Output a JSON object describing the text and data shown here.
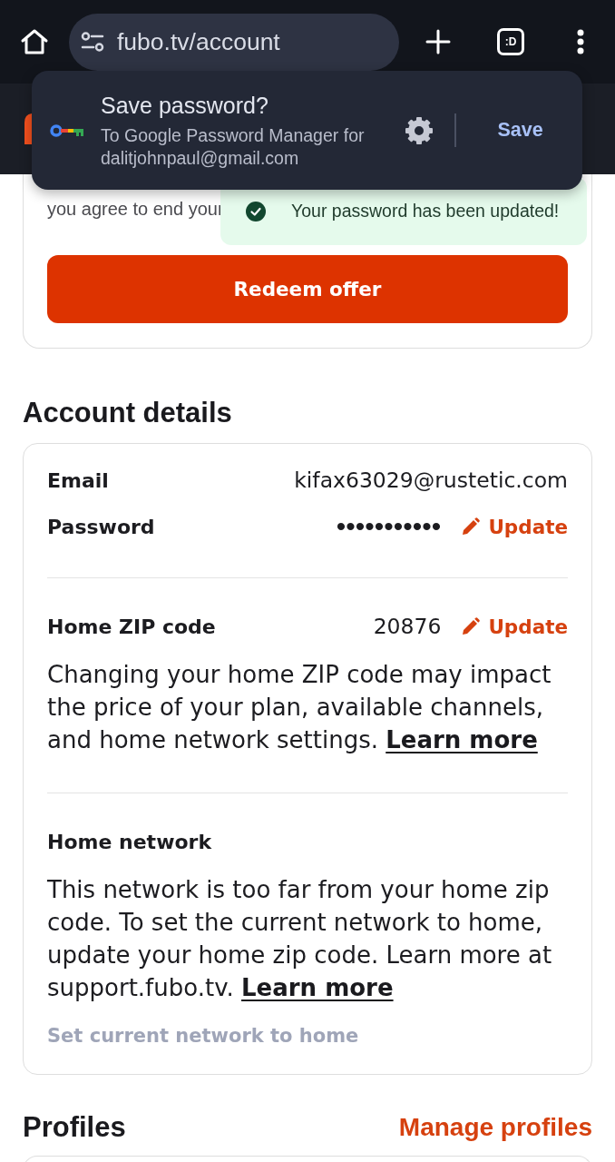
{
  "browser_toolbar": {
    "url": "fubo.tv/account",
    "tab_count": ":D"
  },
  "password_prompt": {
    "title": "Save password?",
    "subtitle": "To Google Password Manager for dalitjohnpaul@gmail.com",
    "action": "Save"
  },
  "toast": {
    "message": "Your password has been updated!"
  },
  "offer_card": {
    "text": "you agree to end your",
    "button": "Redeem offer"
  },
  "account_details": {
    "heading": "Account details",
    "sections": [
      {
        "rows": [
          {
            "label": "Email",
            "value": "kifax63029@rustetic.com"
          },
          {
            "label": "Password",
            "value": "•••••••••••",
            "action": "Update"
          }
        ]
      },
      {
        "rows": [
          {
            "label": "Home ZIP code",
            "value": "20876",
            "action": "Update"
          }
        ],
        "note": {
          "text": "Changing your home ZIP code may impact the price of your plan, available channels, and home network settings.",
          "link": "Learn more"
        }
      },
      {
        "rows": [
          {
            "label": "Home network"
          }
        ],
        "note": {
          "text": "This network is too far from your home zip code. To set the current network to home, update your home zip code. Learn more at support.fubo.tv.",
          "link": "Learn more"
        },
        "button": {
          "label": "Set current network to home",
          "disabled": true
        }
      }
    ]
  },
  "profiles": {
    "heading": "Profiles",
    "action": "Manage profiles"
  }
}
